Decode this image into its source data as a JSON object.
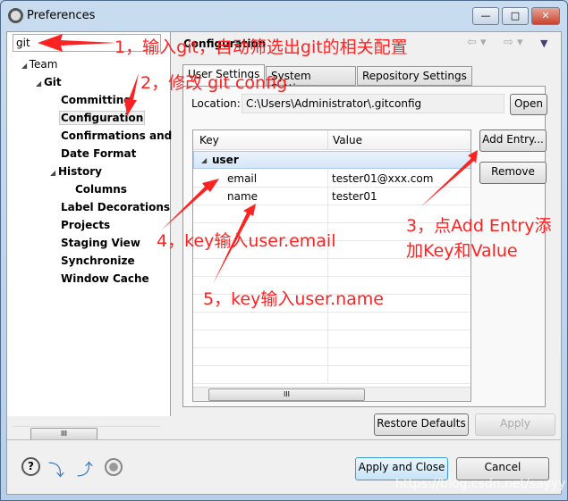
{
  "window": {
    "title": "Preferences",
    "minimize": "—",
    "maximize": "□",
    "close": "✕"
  },
  "filter": {
    "value": "git"
  },
  "tree": [
    {
      "label": "Team",
      "level": 0
    },
    {
      "label": "Git",
      "level": 1
    },
    {
      "label": "Committing"
    },
    {
      "label": "Configuration",
      "selected": true
    },
    {
      "label": "Confirmations and"
    },
    {
      "label": "Date Format"
    },
    {
      "label": "History"
    },
    {
      "label": "Columns"
    },
    {
      "label": "Label Decorations"
    },
    {
      "label": "Projects"
    },
    {
      "label": "Staging View"
    },
    {
      "label": "Synchronize"
    },
    {
      "label": "Window Cache"
    }
  ],
  "page": {
    "title": "Configuration",
    "tabs": [
      "User Settings",
      "System Settings",
      "Repository Settings"
    ],
    "active_tab": "User Settings",
    "location_label": "Location:",
    "location_value": "C:\\Users\\Administrator\\.gitconfig",
    "open": "Open",
    "columns": [
      "Key",
      "Value"
    ],
    "rows": [
      {
        "key": "user",
        "value": "",
        "section": true
      },
      {
        "key": "email",
        "value": "tester01@xxx.com"
      },
      {
        "key": "name",
        "value": "tester01"
      }
    ],
    "add_entry": "Add Entry...",
    "remove": "Remove",
    "restore_defaults": "Restore Defaults",
    "apply": "Apply"
  },
  "footer": {
    "apply_close": "Apply and Close",
    "cancel": "Cancel",
    "watermark": "https://blog.csdn.net/sayyy"
  },
  "annotations": {
    "a1": "1，输入git，自动筛选出git的相关配置",
    "a2": "2，修改 git config",
    "a3_1": "3，点Add Entry添",
    "a3_2": "加Key和Value",
    "a4": "4，key输入user.email",
    "a5": "5，key输入user.name"
  },
  "colors": {
    "annotation": "#ff2222",
    "selection": "#dbe9f8"
  }
}
